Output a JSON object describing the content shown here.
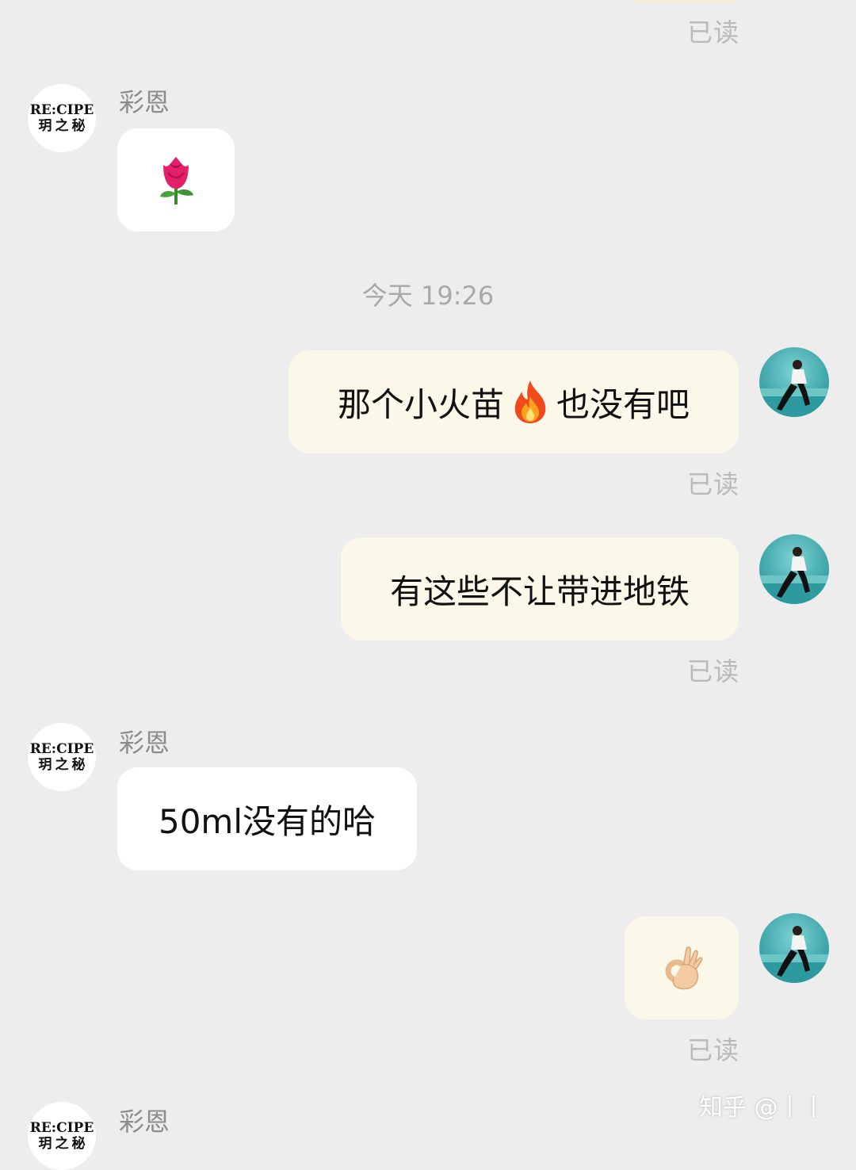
{
  "chat": {
    "read_label": "已读",
    "contact_name": "彩恩",
    "brand_avatar": {
      "line1": "RE:CIPE",
      "line2": "玥之秘"
    },
    "timestamp": "今天 19:26",
    "messages": [
      {
        "direction": "incoming",
        "sender": "彩恩",
        "emoji": "rose",
        "glyph": "🌹"
      },
      {
        "direction": "outgoing",
        "text_before": "那个小火苗",
        "emoji": "fire",
        "glyph": "🔥",
        "text_after": "也没有吧",
        "status": "已读"
      },
      {
        "direction": "outgoing",
        "text": "有这些不让带进地铁",
        "status": "已读"
      },
      {
        "direction": "incoming",
        "sender": "彩恩",
        "text": "50ml没有的哈"
      },
      {
        "direction": "outgoing",
        "emoji": "ok-hand",
        "glyph": "👌",
        "status": "已读"
      },
      {
        "direction": "incoming",
        "sender": "彩恩"
      }
    ]
  },
  "watermark": "知乎 @丨丨",
  "colors": {
    "background": "#ededed",
    "incoming_bubble": "#ffffff",
    "outgoing_bubble": "#fbf7e9",
    "meta_text": "#b9b9b9"
  }
}
